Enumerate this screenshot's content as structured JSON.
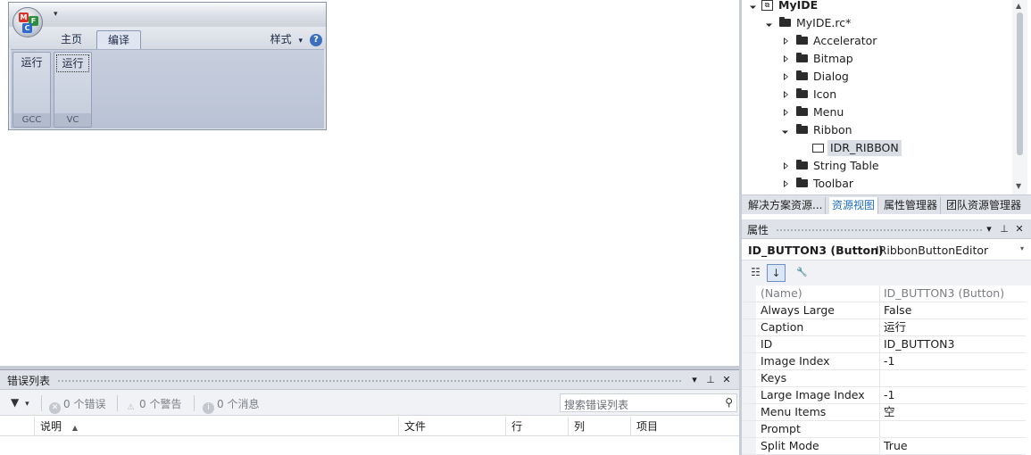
{
  "ribbon": {
    "app_button_letters": [
      "M",
      "F",
      "C"
    ],
    "qat_arrow": "▾",
    "tabs": [
      {
        "label": "主页",
        "active": false
      },
      {
        "label": "编译",
        "active": true
      }
    ],
    "style_label": "样式",
    "style_arrow": "▾",
    "help": "?",
    "groups": [
      {
        "button": "运行",
        "label": "GCC"
      },
      {
        "button": "运行",
        "label": "VC"
      }
    ]
  },
  "error_list": {
    "title": "错误列表",
    "header_buttons": {
      "dropdown": "▾",
      "pin": "⊥",
      "close": "✕"
    },
    "filter_icon": "▼",
    "filter_arrow": "▾",
    "errors": "0 个错误",
    "warnings": "0 个警告",
    "messages": "0 个消息",
    "search_placeholder": "搜索错误列表",
    "search_icon": "⚲",
    "columns": [
      "说明",
      "文件",
      "行",
      "列",
      "项目"
    ],
    "sort_arrow": "▲"
  },
  "resource_tree": {
    "root": "MyIDE",
    "rc_file": "MyIDE.rc*",
    "folders": [
      {
        "label": "Accelerator",
        "expanded": false
      },
      {
        "label": "Bitmap",
        "expanded": false
      },
      {
        "label": "Dialog",
        "expanded": false
      },
      {
        "label": "Icon",
        "expanded": false
      },
      {
        "label": "Menu",
        "expanded": false
      },
      {
        "label": "Ribbon",
        "expanded": true
      },
      {
        "label": "String Table",
        "expanded": false
      },
      {
        "label": "Toolbar",
        "expanded": false
      }
    ],
    "ribbon_child": "IDR_RIBBON"
  },
  "bottom_tabs": [
    {
      "label": "解决方案资源...",
      "active": false
    },
    {
      "label": "资源视图",
      "active": true
    },
    {
      "label": "属性管理器",
      "active": false
    },
    {
      "label": "团队资源管理器",
      "active": false
    }
  ],
  "properties": {
    "title": "属性",
    "header_buttons": {
      "dropdown": "▾",
      "pin": "⊥",
      "close": "✕"
    },
    "object_name": "ID_BUTTON3 (Button)",
    "object_type": "IRibbonButtonEditor",
    "object_dropdown": "▾",
    "toolbar": {
      "categorized": "☷",
      "alphabetical": "↓",
      "property_pages": "🔧"
    },
    "rows": [
      {
        "name": "(Name)",
        "value": "ID_BUTTON3 (Button)",
        "dim": true
      },
      {
        "name": "Always Large",
        "value": "False",
        "dim": false
      },
      {
        "name": "Caption",
        "value": "运行",
        "dim": false
      },
      {
        "name": "ID",
        "value": "ID_BUTTON3",
        "dim": false
      },
      {
        "name": "Image Index",
        "value": "-1",
        "dim": false
      },
      {
        "name": "Keys",
        "value": "",
        "dim": false
      },
      {
        "name": "Large Image Index",
        "value": "-1",
        "dim": false
      },
      {
        "name": "Menu Items",
        "value": "空",
        "dim": false
      },
      {
        "name": "Prompt",
        "value": "",
        "dim": false
      },
      {
        "name": "Split Mode",
        "value": "True",
        "dim": false
      }
    ]
  },
  "colors": {
    "active_tab_text": "#1c6cc4",
    "panel_header": "#dfe2e8",
    "ribbon_panel": "#c3cbda"
  }
}
